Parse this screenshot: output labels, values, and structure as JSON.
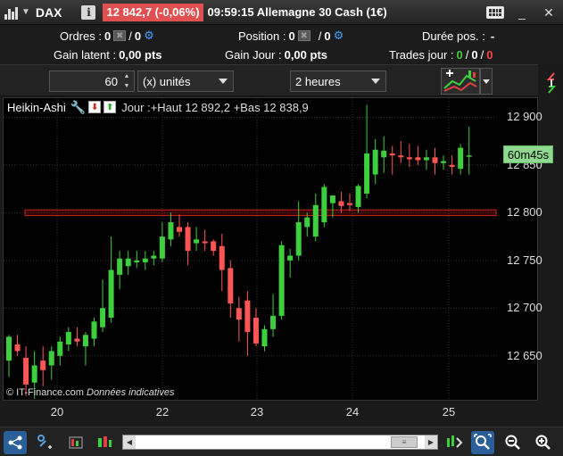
{
  "titlebar": {
    "instrument": "DAX",
    "info_label": "i",
    "price_change": "12 842,7 (-0,06%)",
    "time": "09:59:15",
    "market_name": "Allemagne 30 Cash (1€)",
    "minimize": "_",
    "close": "✕"
  },
  "info": {
    "orders_label": "Ordres :",
    "orders_val1": "0",
    "orders_sep": "/",
    "orders_val2": "0",
    "position_label": "Position :",
    "position_val1": "0",
    "position_sep": "/",
    "position_val2": "0",
    "duration_label": "Durée pos. :",
    "duration_val": "-",
    "gain_latent_label": "Gain latent :",
    "gain_latent_val": "0,00 pts",
    "gain_jour_label": "Gain Jour :",
    "gain_jour_val": "0,00 pts",
    "trades_label": "Trades jour :",
    "trades_win": "0",
    "trades_sep1": "/",
    "trades_neutral": "0",
    "trades_sep2": "/",
    "trades_loss": "0"
  },
  "toolbar": {
    "quantity": "60",
    "units_selected": "(x) unités",
    "period_selected": "2 heures"
  },
  "chart_header": {
    "chart_type": "Heikin-Ashi",
    "info_text": "Jour :+Haut 12 892,2 +Bas 12 838,9"
  },
  "watermark": {
    "source": "© IT-Finance.com",
    "note": "Données indicatives"
  },
  "timer": "60m45s",
  "colors": {
    "up": "#3ecf3e",
    "down": "#ff5555",
    "price_badge": "#e05050",
    "timer_bg": "#8fd88f",
    "zone": "#cc2222"
  },
  "chart_data": {
    "type": "heikin-ashi candlestick",
    "ylim": [
      12604,
      12920
    ],
    "yticks": [
      "12 900",
      "12 850",
      "12 800",
      "12 750",
      "12 700",
      "12 650"
    ],
    "ytick_values": [
      12900,
      12850,
      12800,
      12750,
      12700,
      12650
    ],
    "xticks": [
      "20",
      "22",
      "23",
      "24",
      "25"
    ],
    "zone": {
      "low": 12797,
      "high": 12803
    },
    "candles": [
      {
        "o": 12645,
        "h": 12672,
        "l": 12628,
        "c": 12670
      },
      {
        "o": 12662,
        "h": 12672,
        "l": 12650,
        "c": 12655
      },
      {
        "o": 12648,
        "h": 12660,
        "l": 12608,
        "c": 12620
      },
      {
        "o": 12622,
        "h": 12655,
        "l": 12605,
        "c": 12640
      },
      {
        "o": 12645,
        "h": 12660,
        "l": 12618,
        "c": 12635
      },
      {
        "o": 12640,
        "h": 12660,
        "l": 12625,
        "c": 12655
      },
      {
        "o": 12650,
        "h": 12670,
        "l": 12640,
        "c": 12665
      },
      {
        "o": 12662,
        "h": 12680,
        "l": 12655,
        "c": 12675
      },
      {
        "o": 12668,
        "h": 12680,
        "l": 12660,
        "c": 12665
      },
      {
        "o": 12660,
        "h": 12675,
        "l": 12640,
        "c": 12672
      },
      {
        "o": 12668,
        "h": 12690,
        "l": 12660,
        "c": 12686
      },
      {
        "o": 12680,
        "h": 12730,
        "l": 12675,
        "c": 12700
      },
      {
        "o": 12690,
        "h": 12775,
        "l": 12685,
        "c": 12740
      },
      {
        "o": 12735,
        "h": 12760,
        "l": 12720,
        "c": 12752
      },
      {
        "o": 12744,
        "h": 12760,
        "l": 12735,
        "c": 12752
      },
      {
        "o": 12748,
        "h": 12760,
        "l": 12742,
        "c": 12750
      },
      {
        "o": 12748,
        "h": 12760,
        "l": 12740,
        "c": 12752
      },
      {
        "o": 12752,
        "h": 12760,
        "l": 12745,
        "c": 12755
      },
      {
        "o": 12752,
        "h": 12790,
        "l": 12748,
        "c": 12775
      },
      {
        "o": 12772,
        "h": 12800,
        "l": 12765,
        "c": 12790
      },
      {
        "o": 12785,
        "h": 12798,
        "l": 12775,
        "c": 12780
      },
      {
        "o": 12785,
        "h": 12790,
        "l": 12745,
        "c": 12760
      },
      {
        "o": 12768,
        "h": 12785,
        "l": 12760,
        "c": 12772
      },
      {
        "o": 12770,
        "h": 12782,
        "l": 12760,
        "c": 12768
      },
      {
        "o": 12770,
        "h": 12772,
        "l": 12755,
        "c": 12760
      },
      {
        "o": 12765,
        "h": 12778,
        "l": 12718,
        "c": 12740
      },
      {
        "o": 12742,
        "h": 12750,
        "l": 12690,
        "c": 12705
      },
      {
        "o": 12700,
        "h": 12712,
        "l": 12665,
        "c": 12688
      },
      {
        "o": 12708,
        "h": 12718,
        "l": 12650,
        "c": 12675
      },
      {
        "o": 12690,
        "h": 12700,
        "l": 12660,
        "c": 12663
      },
      {
        "o": 12660,
        "h": 12682,
        "l": 12655,
        "c": 12678
      },
      {
        "o": 12678,
        "h": 12715,
        "l": 12670,
        "c": 12692
      },
      {
        "o": 12692,
        "h": 12770,
        "l": 12688,
        "c": 12766
      },
      {
        "o": 12750,
        "h": 12762,
        "l": 12732,
        "c": 12755
      },
      {
        "o": 12755,
        "h": 12812,
        "l": 12750,
        "c": 12790
      },
      {
        "o": 12785,
        "h": 12800,
        "l": 12775,
        "c": 12795
      },
      {
        "o": 12775,
        "h": 12820,
        "l": 12770,
        "c": 12808
      },
      {
        "o": 12790,
        "h": 12830,
        "l": 12785,
        "c": 12827
      },
      {
        "o": 12810,
        "h": 12818,
        "l": 12795,
        "c": 12818
      },
      {
        "o": 12812,
        "h": 12822,
        "l": 12800,
        "c": 12807
      },
      {
        "o": 12810,
        "h": 12820,
        "l": 12802,
        "c": 12808
      },
      {
        "o": 12806,
        "h": 12830,
        "l": 12800,
        "c": 12828
      },
      {
        "o": 12820,
        "h": 12913,
        "l": 12815,
        "c": 12862
      },
      {
        "o": 12840,
        "h": 12877,
        "l": 12830,
        "c": 12866
      },
      {
        "o": 12858,
        "h": 12880,
        "l": 12842,
        "c": 12865
      },
      {
        "o": 12862,
        "h": 12870,
        "l": 12840,
        "c": 12860
      },
      {
        "o": 12860,
        "h": 12875,
        "l": 12852,
        "c": 12858
      },
      {
        "o": 12858,
        "h": 12872,
        "l": 12848,
        "c": 12856
      },
      {
        "o": 12858,
        "h": 12870,
        "l": 12850,
        "c": 12855
      },
      {
        "o": 12855,
        "h": 12866,
        "l": 12845,
        "c": 12858
      },
      {
        "o": 12858,
        "h": 12868,
        "l": 12840,
        "c": 12852
      },
      {
        "o": 12852,
        "h": 12860,
        "l": 12845,
        "c": 12854
      },
      {
        "o": 12850,
        "h": 12860,
        "l": 12840,
        "c": 12848
      },
      {
        "o": 12846,
        "h": 12872,
        "l": 12840,
        "c": 12868
      },
      {
        "o": 12860,
        "h": 12890,
        "l": 12840,
        "c": 12860
      }
    ]
  }
}
